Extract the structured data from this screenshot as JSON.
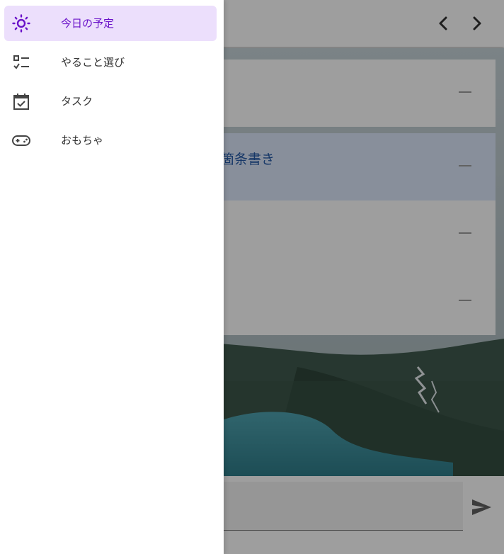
{
  "drawer": {
    "items": [
      {
        "label": "今日の予定",
        "icon": "sun-icon",
        "active": true
      },
      {
        "label": "やること選び",
        "icon": "checklist-icon",
        "active": false
      },
      {
        "label": "タスク",
        "icon": "calendar-check-icon",
        "active": false
      },
      {
        "label": "おもちゃ",
        "icon": "gamepad-icon",
        "active": false
      }
    ]
  },
  "header": {
    "prev_icon": "chevron-left-icon",
    "next_icon": "chevron-right-icon"
  },
  "list": {
    "rows": [
      {
        "text": "",
        "highlighted": false
      },
      {
        "text": "箇条書き",
        "highlighted": true
      },
      {
        "text": "",
        "highlighted": false
      },
      {
        "text": "",
        "highlighted": false
      }
    ],
    "row_action_icon": "minus-icon"
  },
  "composer": {
    "send_icon": "send-icon"
  },
  "colors": {
    "accent": "#6a12c9",
    "active_bg": "#ecdffc",
    "highlight_row": "#dbe7fb",
    "row_text": "#245aa6"
  }
}
